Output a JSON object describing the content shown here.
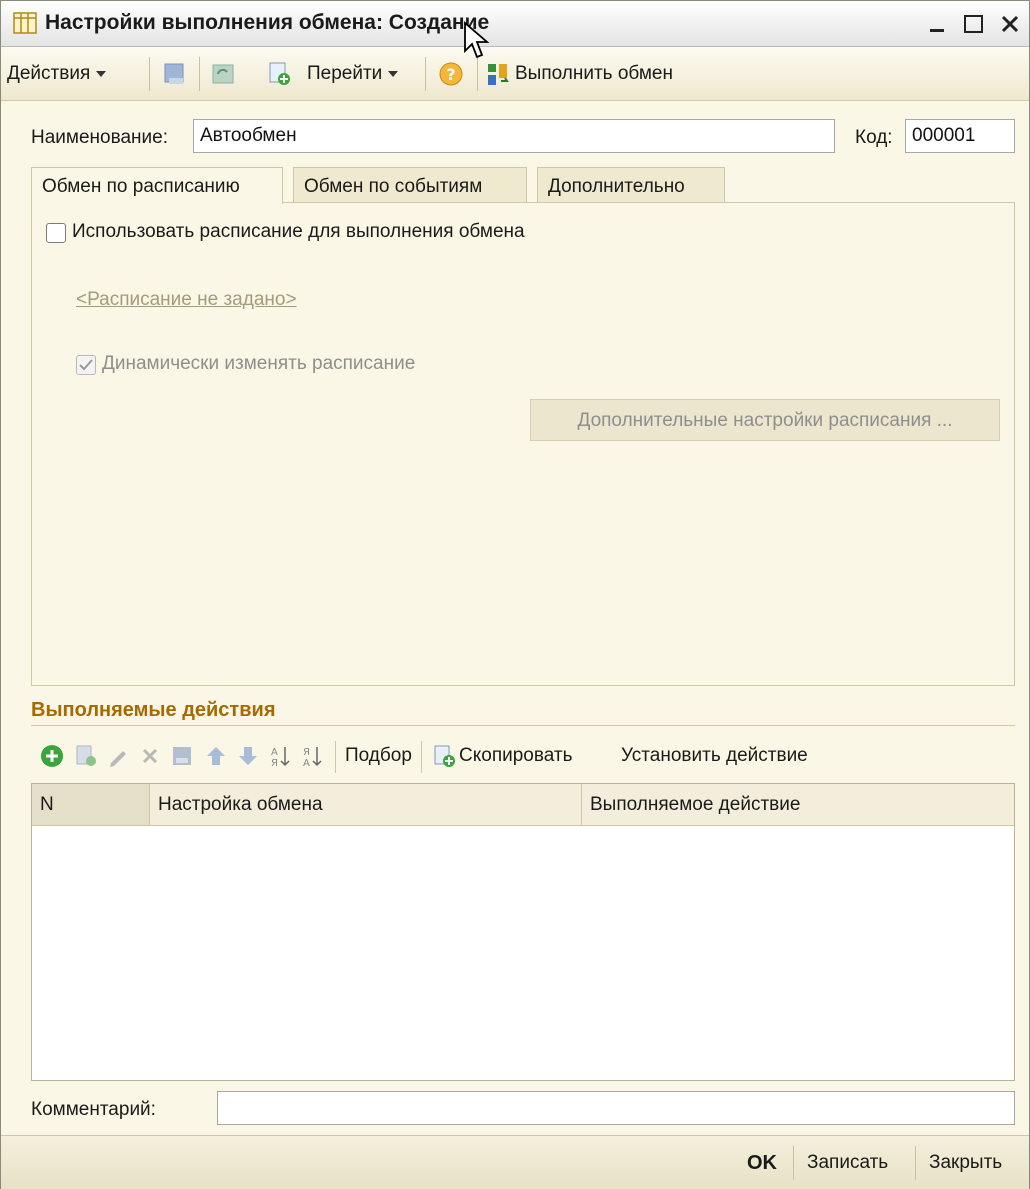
{
  "window": {
    "title": "Настройки выполнения обмена: Создание"
  },
  "toolbar": {
    "actions_label": "Действия",
    "goto_label": "Перейти",
    "run_exchange_label": "Выполнить обмен"
  },
  "header": {
    "name_label": "Наименование:",
    "name_value": "Автообмен",
    "code_label": "Код:",
    "code_value": "000001"
  },
  "tabs": [
    {
      "label": "Обмен по расписанию",
      "active": true
    },
    {
      "label": "Обмен по событиям",
      "active": false
    },
    {
      "label": "Дополнительно",
      "active": false
    }
  ],
  "schedule": {
    "use_schedule_label": "Использовать расписание для выполнения обмена",
    "use_schedule_checked": false,
    "schedule_link": "<Расписание не задано>",
    "dynamic_label": "Динамически изменять расписание",
    "dynamic_checked": true,
    "extra_settings_button": "Дополнительные настройки расписания ..."
  },
  "actions_section": {
    "title": "Выполняемые действия",
    "pick_label": "Подбор",
    "copy_label": "Скопировать",
    "set_action_label": "Установить действие",
    "columns": [
      "N",
      "Настройка обмена",
      "Выполняемое действие"
    ],
    "rows": []
  },
  "comment": {
    "label": "Комментарий:",
    "value": ""
  },
  "footer": {
    "ok_label": "OK",
    "save_label": "Записать",
    "close_label": "Закрыть"
  },
  "colors": {
    "form_background": "#fbf7e6",
    "section_title": "#a76900",
    "link_disabled": "#a49b7c"
  }
}
